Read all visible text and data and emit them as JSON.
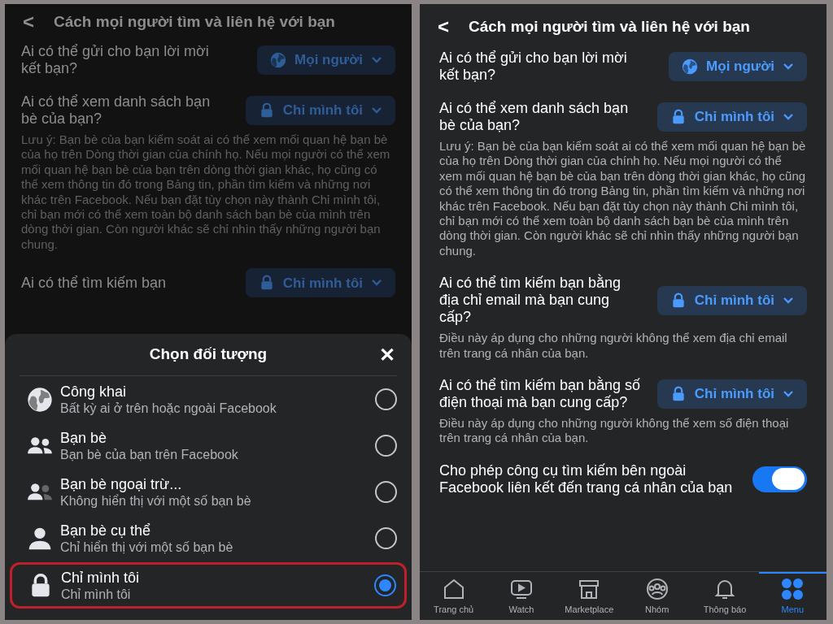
{
  "left_panel": {
    "header": {
      "back": "<",
      "title": "Cách mọi người tìm và liên hệ với bạn"
    },
    "settings": [
      {
        "question": "Ai có thể gửi cho bạn lời mời kết bạn?",
        "value": "Mọi người",
        "kind": "public"
      },
      {
        "question": "Ai có thể xem danh sách bạn bè của bạn?",
        "value": "Chỉ mình tôi",
        "kind": "private",
        "note": "Lưu ý: Bạn bè của bạn kiểm soát ai có thể xem mối quan hệ bạn bè của họ trên Dòng thời gian của chính họ. Nếu mọi người có thể xem mối quan hệ bạn bè của bạn trên dòng thời gian khác, họ cũng có thể xem thông tin đó trong Bảng tin, phần tìm kiếm và những nơi khác trên Facebook. Nếu bạn đặt tùy chọn này thành Chỉ mình tôi, chỉ bạn mới có thể xem toàn bộ danh sách bạn bè của mình trên dòng thời gian. Còn người khác sẽ chỉ nhìn thấy những người bạn chung."
      },
      {
        "question": "Ai có thể tìm kiếm bạn",
        "value": "Chỉ mình tôi",
        "kind": "private"
      }
    ],
    "sheet": {
      "title": "Chọn đối tượng",
      "close": "✕",
      "options": [
        {
          "title": "Công khai",
          "subtitle": "Bất kỳ ai ở trên hoặc ngoài Facebook",
          "kind": "public",
          "selected": false
        },
        {
          "title": "Bạn bè",
          "subtitle": "Bạn bè của bạn trên Facebook",
          "kind": "friends",
          "selected": false
        },
        {
          "title": "Bạn bè ngoại trừ...",
          "subtitle": "Không hiển thị với một số bạn bè",
          "kind": "friends_except",
          "selected": false
        },
        {
          "title": "Bạn bè cụ thể",
          "subtitle": "Chỉ hiển thị với một số bạn bè",
          "kind": "specific",
          "selected": false
        },
        {
          "title": "Chỉ mình tôi",
          "subtitle": "Chỉ mình tôi",
          "kind": "private",
          "selected": true
        }
      ]
    }
  },
  "right_panel": {
    "header": {
      "back": "<",
      "title": "Cách mọi người tìm và liên hệ với bạn"
    },
    "settings": [
      {
        "question": "Ai có thể gửi cho bạn lời mời kết bạn?",
        "value": "Mọi người",
        "kind": "public"
      },
      {
        "question": "Ai có thể xem danh sách bạn bè của bạn?",
        "value": "Chỉ mình tôi",
        "kind": "private",
        "note": "Lưu ý: Bạn bè của bạn kiểm soát ai có thể xem mối quan hệ bạn bè của họ trên Dòng thời gian của chính họ. Nếu mọi người có thể xem mối quan hệ bạn bè của bạn trên dòng thời gian khác, họ cũng có thể xem thông tin đó trong Bảng tin, phần tìm kiếm và những nơi khác trên Facebook. Nếu bạn đặt tùy chọn này thành Chỉ mình tôi, chỉ bạn mới có thể xem toàn bộ danh sách bạn bè của mình trên dòng thời gian. Còn người khác sẽ chỉ nhìn thấy những người bạn chung."
      },
      {
        "question": "Ai có thể tìm kiếm bạn bằng địa chỉ email mà bạn cung cấp?",
        "value": "Chỉ mình tôi",
        "kind": "private",
        "note": "Điều này áp dụng cho những người không thể xem địa chỉ email trên trang cá nhân của bạn."
      },
      {
        "question": "Ai có thể tìm kiếm bạn bằng số điện thoại mà bạn cung cấp?",
        "value": "Chỉ mình tôi",
        "kind": "private",
        "note": "Điều này áp dụng cho những người không thể xem số điện thoại trên trang cá nhân của bạn."
      }
    ],
    "toggle": {
      "label": "Cho phép công cụ tìm kiếm bên ngoài Facebook liên kết đến trang cá nhân của bạn",
      "on": true
    },
    "nav": [
      {
        "label": "Trang chủ",
        "kind": "home",
        "selected": false
      },
      {
        "label": "Watch",
        "kind": "watch",
        "selected": false
      },
      {
        "label": "Marketplace",
        "kind": "market",
        "selected": false
      },
      {
        "label": "Nhóm",
        "kind": "groups",
        "selected": false
      },
      {
        "label": "Thông báo",
        "kind": "bell",
        "selected": false
      },
      {
        "label": "Menu",
        "kind": "menu",
        "selected": true
      }
    ]
  }
}
